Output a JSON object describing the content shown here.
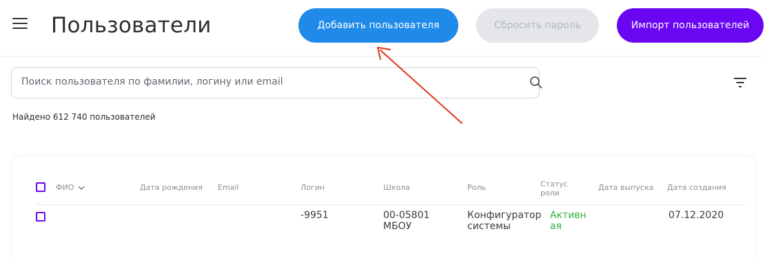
{
  "header": {
    "title": "Пользователи",
    "add_user_label": "Добавить пользователя",
    "reset_password_label": "Сбросить пароль",
    "import_users_label": "Импорт пользователей"
  },
  "search": {
    "placeholder": "Поиск пользователя по фамилии, логину или email",
    "value": ""
  },
  "results": {
    "found_text": "Найдено 612 740 пользователей"
  },
  "table": {
    "columns": {
      "fio": "ФИО",
      "birth_date": "Дата рождения",
      "email": "Email",
      "login": "Логин",
      "school": "Школа",
      "role": "Роль",
      "role_status_line1": "Статус",
      "role_status_line2": "роли",
      "release_date": "Дата выпуска",
      "created_date": "Дата создания"
    },
    "rows": [
      {
        "fio": "",
        "birth_date": "",
        "email": "",
        "login": "-9951",
        "school_line1": "00-05801",
        "school_line2": "МБОУ",
        "role_line1": "Конфигуратор",
        "role_line2": "системы",
        "status_line1": "Активн",
        "status_line2": "ая",
        "release_date": "",
        "created_date": "07.12.2020"
      }
    ]
  },
  "icons": {
    "menu": "menu-icon",
    "search": "search-icon",
    "filter": "filter-icon",
    "sort": "chevron-down-icon",
    "annotation": "annotation-arrow"
  },
  "colors": {
    "add_button": "#1f8ae8",
    "import_button": "#6a06f2",
    "disabled_button": "#e4e6ea",
    "checkbox_accent": "#6a06f2",
    "status_active": "#2db43a",
    "annotation_arrow": "#e0442f"
  }
}
